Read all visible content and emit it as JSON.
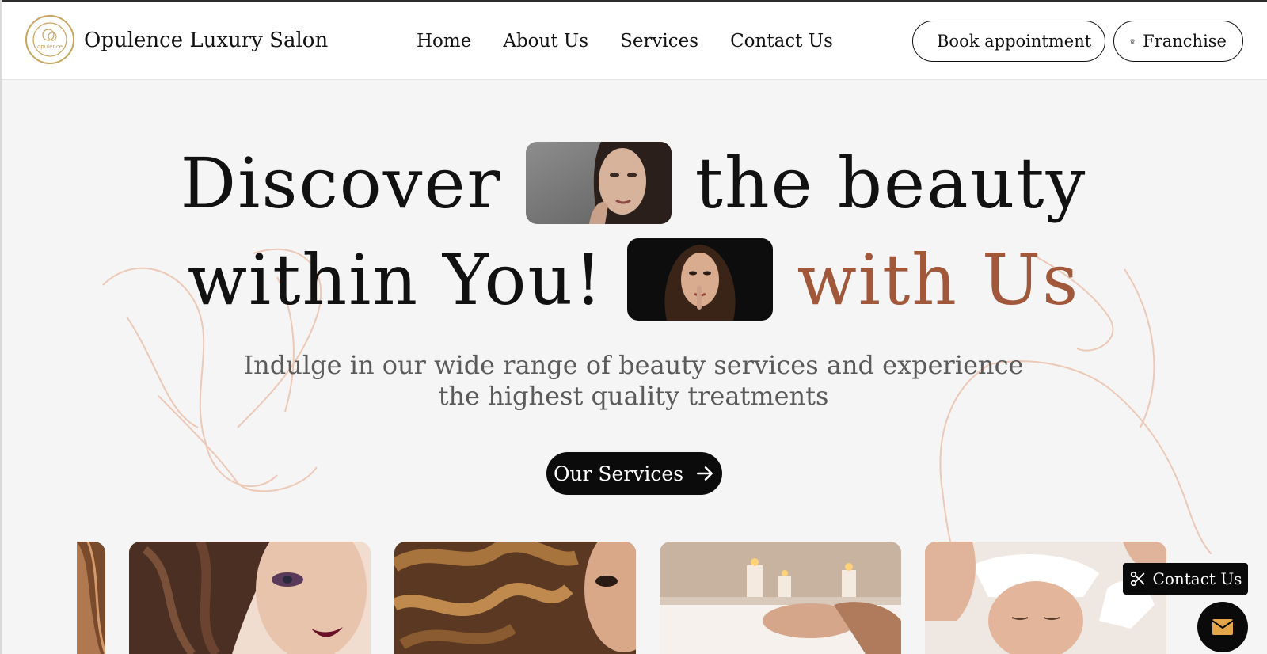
{
  "brand": {
    "name": "Opulence Luxury Salon",
    "logo_text": "opulence"
  },
  "nav": {
    "items": [
      {
        "label": "Home"
      },
      {
        "label": "About Us"
      },
      {
        "label": "Services"
      },
      {
        "label": "Contact Us"
      }
    ]
  },
  "header_buttons": {
    "book": {
      "label": "Book appointment",
      "icon": "phone-icon"
    },
    "franchise": {
      "label": "Franchise",
      "icon": "store-icon"
    }
  },
  "hero": {
    "line1_word1": "Discover",
    "line1_word2": "the beauty",
    "line2_word1": "within You!",
    "line2_accent": "with Us",
    "subtitle": "Indulge in our wide range of beauty services and experience the highest quality treatments",
    "cta_label": "Our Services",
    "cta_icon": "arrow-right-icon"
  },
  "gallery": {
    "cards": [
      {
        "subject": "hair-photo"
      },
      {
        "subject": "makeup-model-photo"
      },
      {
        "subject": "curly-hair-photo"
      },
      {
        "subject": "spa-massage-photo"
      },
      {
        "subject": "facial-treatment-photo"
      }
    ]
  },
  "floating": {
    "contact_label": "Contact Us",
    "contact_icon": "scissors-icon",
    "mail_icon": "mail-icon"
  },
  "colors": {
    "accent": "#a0573a",
    "logo_gold": "#c9a45c",
    "background": "#f5f5f5",
    "button_dark": "#0b0b0b"
  }
}
